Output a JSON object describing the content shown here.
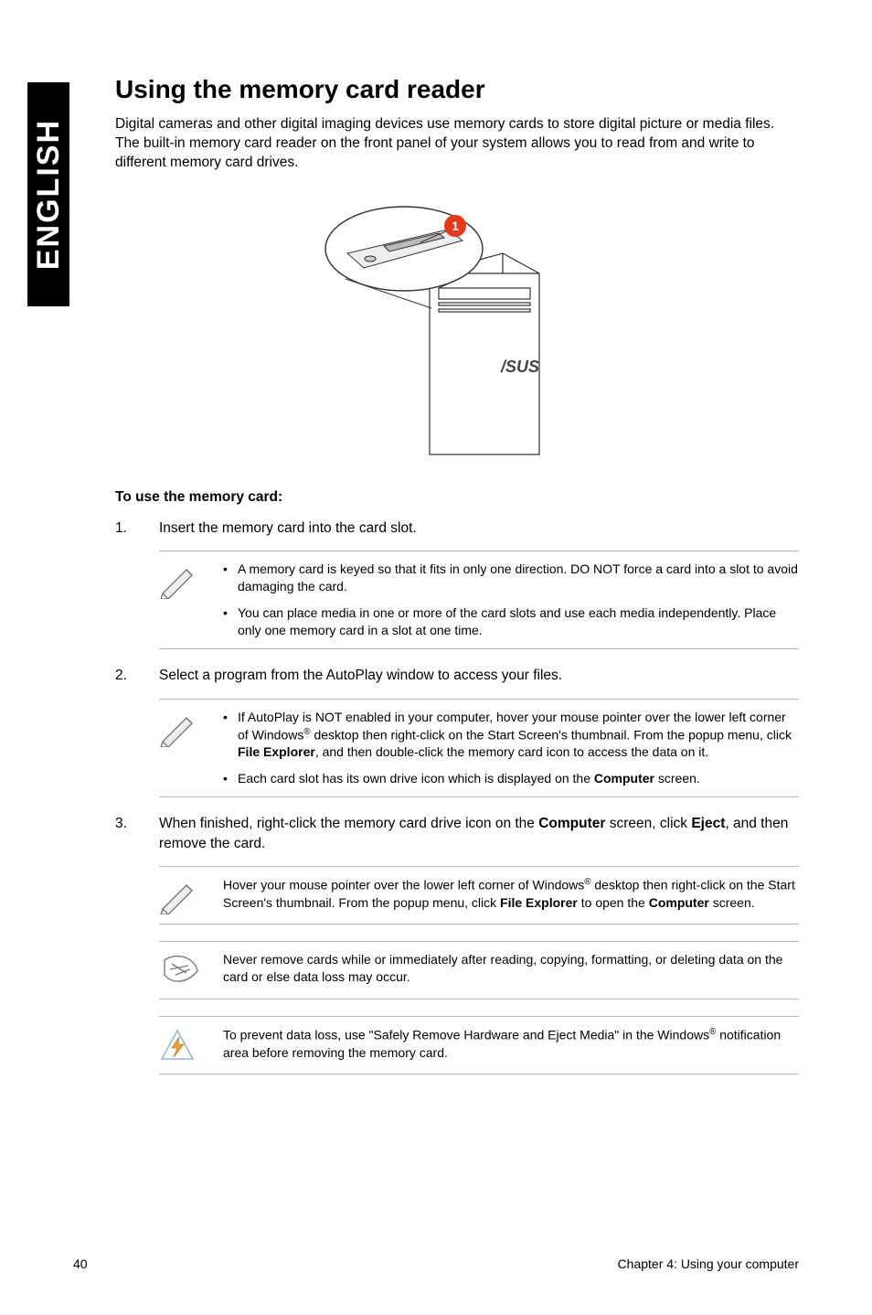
{
  "sideTab": "ENGLISH",
  "title": "Using the memory card reader",
  "intro": "Digital cameras and other digital imaging devices use memory cards to store digital picture or media files. The built-in memory card reader on the front panel of your system allows you to read from and write to different memory card drives.",
  "subhead": "To use the memory card:",
  "calloutNumber": "1",
  "steps": {
    "s1": {
      "num": "1.",
      "text": "Insert the memory card into the card slot."
    },
    "s2": {
      "num": "2.",
      "text": "Select a program from the AutoPlay window to access your files."
    },
    "s3": {
      "num": "3.",
      "prefix": "When finished, right-click the memory card drive icon on the ",
      "bold1": "Computer",
      "mid": " screen, click ",
      "bold2": "Eject",
      "suffix": ", and then remove the card."
    }
  },
  "note1": {
    "li1": "A memory card is keyed so that it fits in only one direction. DO NOT force a card into a slot to avoid damaging the card.",
    "li2": "You can place media in one or more of the card slots and use each media independently. Place only one memory card in a slot at one time."
  },
  "note2": {
    "li1_a": "If AutoPlay is NOT enabled in your computer, hover your mouse pointer over the lower left corner of Windows",
    "li1_b": " desktop then right-click on the Start Screen's thumbnail. From the popup menu, click ",
    "li1_bold": "File Explorer",
    "li1_c": ", and then double-click the memory card icon to access the data on it.",
    "li2_a": "Each card slot has its own drive icon which is displayed on the ",
    "li2_bold": "Computer",
    "li2_b": " screen."
  },
  "note3": {
    "a": "Hover your mouse pointer over the lower left corner of Windows",
    "b": " desktop then right-click on the Start Screen's thumbnail. From the popup menu, click ",
    "bold1": "File Explorer",
    "c": " to open the ",
    "bold2": "Computer",
    "d": " screen."
  },
  "note4": "Never remove cards while or immediately after reading, copying, formatting, or deleting data on the card or else data loss may occur.",
  "note5": {
    "a": "To prevent data loss, use \"Safely Remove Hardware and Eject Media\" in the Windows",
    "b": " notification area before removing the memory card."
  },
  "footer": {
    "pageNum": "40",
    "chapter": "Chapter 4: Using your computer"
  }
}
